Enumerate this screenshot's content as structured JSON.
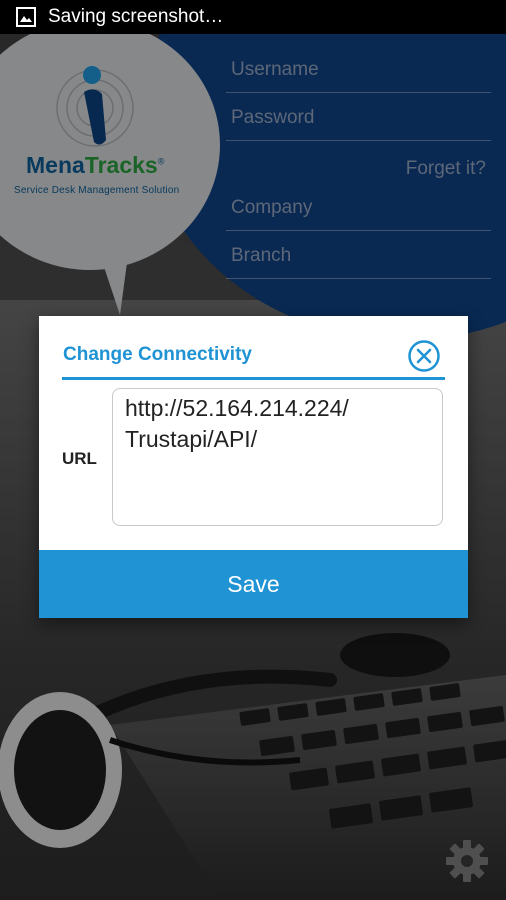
{
  "status_bar": {
    "text": "Saving screenshot…",
    "icon": "image-icon"
  },
  "logo": {
    "name_part1": "Mena",
    "name_part2": "Tracks",
    "trademark": "®",
    "tagline": "Service Desk Management Solution"
  },
  "login_form": {
    "username_placeholder": "Username",
    "password_placeholder": "Password",
    "forget_label": "Forget it?",
    "company_placeholder": "Company",
    "branch_placeholder": "Branch"
  },
  "dialog": {
    "title": "Change Connectivity",
    "url_label": "URL",
    "url_value": "http://52.164.214.224/\nTrustapi/API/",
    "save_label": "Save"
  },
  "colors": {
    "accent": "#1f93d4",
    "panel_blue": "#0e3f80",
    "brand_blue": "#0b5a8f",
    "brand_green": "#2a9a3c"
  },
  "icons": {
    "close": "close-circle-icon",
    "settings": "gear-icon"
  }
}
